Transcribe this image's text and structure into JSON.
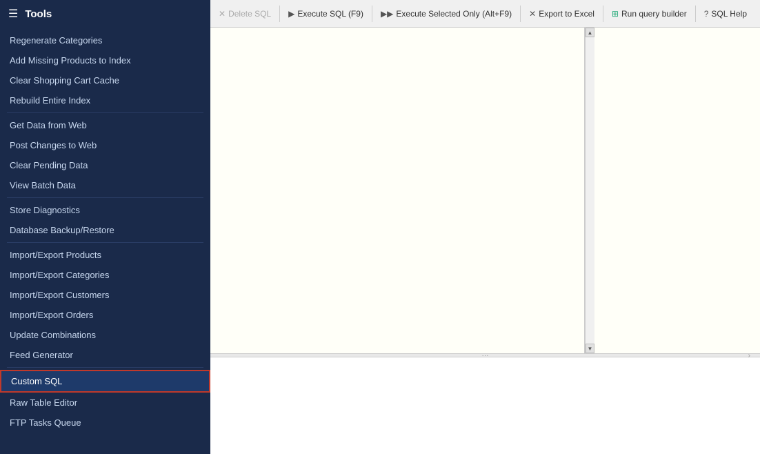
{
  "sidebar": {
    "title": "Tools",
    "menu_items": [
      {
        "id": "regenerate-categories",
        "label": "Regenerate Categories",
        "separator_after": false,
        "active": false
      },
      {
        "id": "add-missing-products",
        "label": "Add Missing Products to Index",
        "separator_after": false,
        "active": false
      },
      {
        "id": "clear-shopping-cart",
        "label": "Clear Shopping Cart Cache",
        "separator_after": false,
        "active": false
      },
      {
        "id": "rebuild-entire-index",
        "label": "Rebuild Entire Index",
        "separator_after": true,
        "active": false
      },
      {
        "id": "get-data-from-web",
        "label": "Get Data from Web",
        "separator_after": false,
        "active": false
      },
      {
        "id": "post-changes-to-web",
        "label": "Post Changes to Web",
        "separator_after": false,
        "active": false
      },
      {
        "id": "clear-pending-data",
        "label": "Clear Pending Data",
        "separator_after": false,
        "active": false
      },
      {
        "id": "view-batch-data",
        "label": "View Batch Data",
        "separator_after": true,
        "active": false
      },
      {
        "id": "store-diagnostics",
        "label": "Store Diagnostics",
        "separator_after": false,
        "active": false
      },
      {
        "id": "database-backup-restore",
        "label": "Database Backup/Restore",
        "separator_after": true,
        "active": false
      },
      {
        "id": "import-export-products",
        "label": "Import/Export Products",
        "separator_after": false,
        "active": false
      },
      {
        "id": "import-export-categories",
        "label": "Import/Export Categories",
        "separator_after": false,
        "active": false
      },
      {
        "id": "import-export-customers",
        "label": "Import/Export Customers",
        "separator_after": false,
        "active": false
      },
      {
        "id": "import-export-orders",
        "label": "Import/Export Orders",
        "separator_after": false,
        "active": false
      },
      {
        "id": "update-combinations",
        "label": "Update Combinations",
        "separator_after": false,
        "active": false
      },
      {
        "id": "feed-generator",
        "label": "Feed Generator",
        "separator_after": true,
        "active": false
      },
      {
        "id": "custom-sql",
        "label": "Custom SQL",
        "separator_after": false,
        "active": true
      },
      {
        "id": "raw-table-editor",
        "label": "Raw Table Editor",
        "separator_after": false,
        "active": false
      },
      {
        "id": "ftp-tasks-queue",
        "label": "FTP Tasks Queue",
        "separator_after": false,
        "active": false
      }
    ]
  },
  "nav_icons": [
    {
      "id": "user",
      "symbol": "👤"
    },
    {
      "id": "tag",
      "symbol": "🏷"
    },
    {
      "id": "chat",
      "symbol": "💬"
    },
    {
      "id": "analytics",
      "symbol": "📊"
    },
    {
      "id": "truck",
      "symbol": "🚚"
    },
    {
      "id": "globe",
      "symbol": "🌐"
    },
    {
      "id": "chart",
      "symbol": "📈"
    },
    {
      "id": "puzzle",
      "symbol": "🧩"
    },
    {
      "id": "sliders",
      "symbol": "⚙"
    },
    {
      "id": "wrench",
      "symbol": "🔧"
    },
    {
      "id": "barcode",
      "symbol": "📋"
    },
    {
      "id": "floppy",
      "symbol": "💾"
    },
    {
      "id": "question",
      "symbol": "❓"
    },
    {
      "id": "lock",
      "symbol": "🔒"
    },
    {
      "id": "gear",
      "symbol": "⚙"
    }
  ],
  "toolbar": {
    "buttons": [
      {
        "id": "delete-sql",
        "label": "Delete SQL",
        "icon": "✕",
        "disabled": true
      },
      {
        "id": "execute-sql",
        "label": "Execute SQL (F9)",
        "icon": "▶",
        "disabled": false
      },
      {
        "id": "execute-selected",
        "label": "Execute Selected Only (Alt+F9)",
        "icon": "▶▶",
        "disabled": false
      },
      {
        "id": "export-excel",
        "label": "Export to Excel",
        "icon": "✕",
        "disabled": false
      },
      {
        "id": "run-query-builder",
        "label": "Run query builder",
        "icon": "⊞",
        "disabled": false
      },
      {
        "id": "sql-help",
        "label": "SQL Help",
        "icon": "?",
        "disabled": false
      }
    ]
  },
  "splitter": {
    "dots": "···"
  }
}
